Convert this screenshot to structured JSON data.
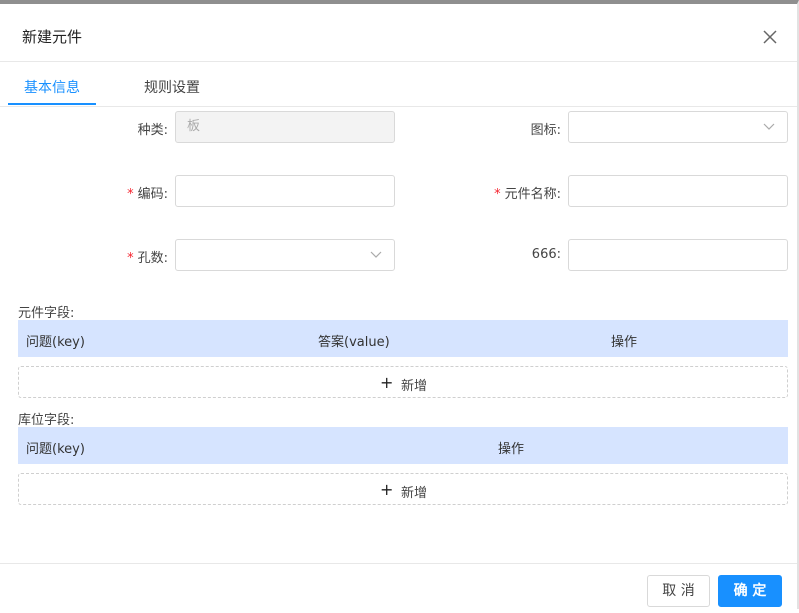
{
  "dialog": {
    "title": "新建元件"
  },
  "tabs": [
    {
      "label": "基本信息"
    },
    {
      "label": "规则设置"
    }
  ],
  "form": {
    "type_label": "种类:",
    "type_value": "板",
    "icon_label": "图标:",
    "code_label": "编码:",
    "name_label": "元件名称:",
    "holes_label": "孔数:",
    "extra_label": "666:",
    "required_mark": "*"
  },
  "component_fields": {
    "title": "元件字段:",
    "columns": [
      "问题(key)",
      "答案(value)",
      "操作"
    ],
    "add_label": "新增"
  },
  "location_fields": {
    "title": "库位字段:",
    "columns": [
      "问题(key)",
      "操作"
    ],
    "add_label": "新增"
  },
  "footer": {
    "cancel_label": "取 消",
    "ok_label": "确 定"
  },
  "colors": {
    "primary": "#1890ff",
    "table_header": "#d6e4ff",
    "required": "#f5222d"
  },
  "icons": {
    "close": "close-icon",
    "dropdown": "chevron-down-icon",
    "add": "plus-icon"
  }
}
